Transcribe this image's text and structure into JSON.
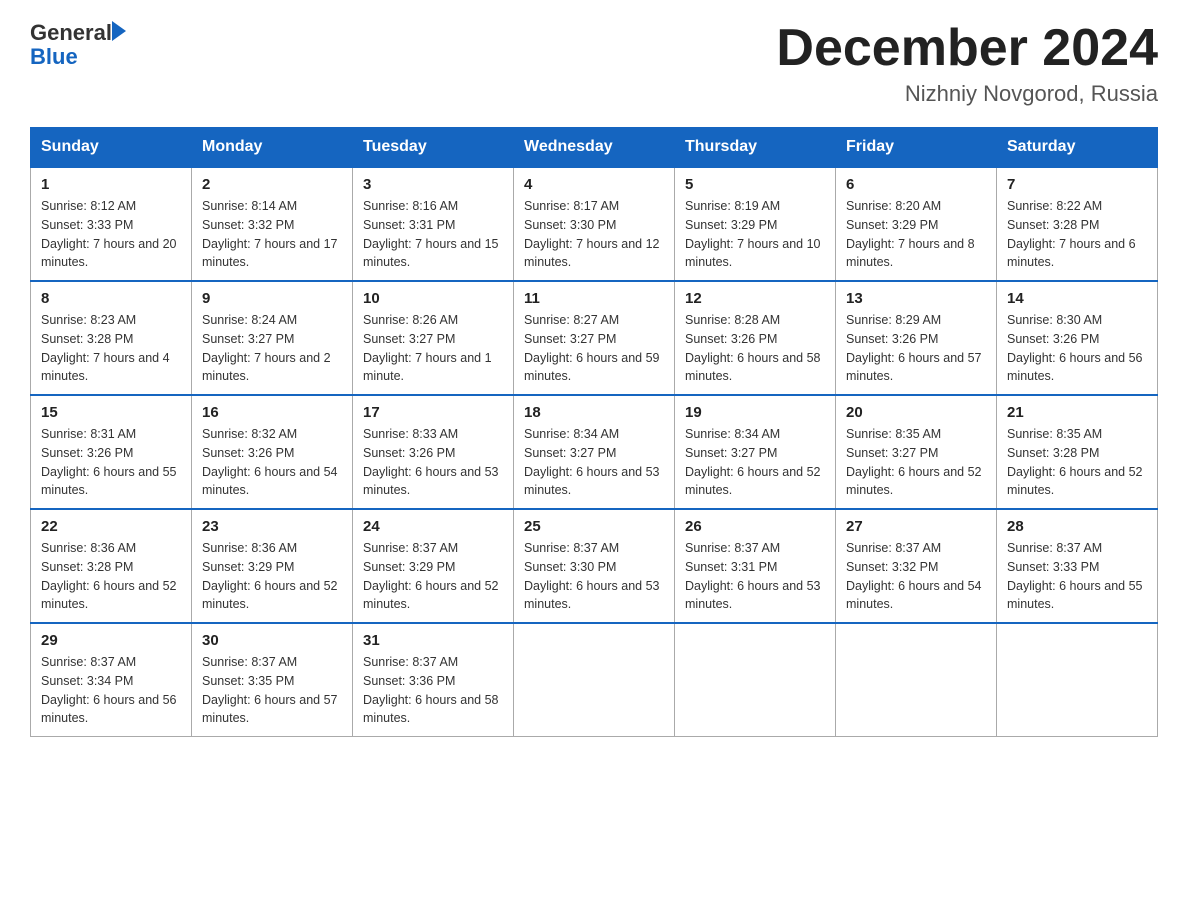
{
  "header": {
    "logo_general": "General",
    "logo_blue": "Blue",
    "title": "December 2024",
    "location": "Nizhniy Novgorod, Russia"
  },
  "weekdays": [
    "Sunday",
    "Monday",
    "Tuesday",
    "Wednesday",
    "Thursday",
    "Friday",
    "Saturday"
  ],
  "weeks": [
    [
      {
        "day": "1",
        "sunrise": "8:12 AM",
        "sunset": "3:33 PM",
        "daylight": "7 hours and 20 minutes."
      },
      {
        "day": "2",
        "sunrise": "8:14 AM",
        "sunset": "3:32 PM",
        "daylight": "7 hours and 17 minutes."
      },
      {
        "day": "3",
        "sunrise": "8:16 AM",
        "sunset": "3:31 PM",
        "daylight": "7 hours and 15 minutes."
      },
      {
        "day": "4",
        "sunrise": "8:17 AM",
        "sunset": "3:30 PM",
        "daylight": "7 hours and 12 minutes."
      },
      {
        "day": "5",
        "sunrise": "8:19 AM",
        "sunset": "3:29 PM",
        "daylight": "7 hours and 10 minutes."
      },
      {
        "day": "6",
        "sunrise": "8:20 AM",
        "sunset": "3:29 PM",
        "daylight": "7 hours and 8 minutes."
      },
      {
        "day": "7",
        "sunrise": "8:22 AM",
        "sunset": "3:28 PM",
        "daylight": "7 hours and 6 minutes."
      }
    ],
    [
      {
        "day": "8",
        "sunrise": "8:23 AM",
        "sunset": "3:28 PM",
        "daylight": "7 hours and 4 minutes."
      },
      {
        "day": "9",
        "sunrise": "8:24 AM",
        "sunset": "3:27 PM",
        "daylight": "7 hours and 2 minutes."
      },
      {
        "day": "10",
        "sunrise": "8:26 AM",
        "sunset": "3:27 PM",
        "daylight": "7 hours and 1 minute."
      },
      {
        "day": "11",
        "sunrise": "8:27 AM",
        "sunset": "3:27 PM",
        "daylight": "6 hours and 59 minutes."
      },
      {
        "day": "12",
        "sunrise": "8:28 AM",
        "sunset": "3:26 PM",
        "daylight": "6 hours and 58 minutes."
      },
      {
        "day": "13",
        "sunrise": "8:29 AM",
        "sunset": "3:26 PM",
        "daylight": "6 hours and 57 minutes."
      },
      {
        "day": "14",
        "sunrise": "8:30 AM",
        "sunset": "3:26 PM",
        "daylight": "6 hours and 56 minutes."
      }
    ],
    [
      {
        "day": "15",
        "sunrise": "8:31 AM",
        "sunset": "3:26 PM",
        "daylight": "6 hours and 55 minutes."
      },
      {
        "day": "16",
        "sunrise": "8:32 AM",
        "sunset": "3:26 PM",
        "daylight": "6 hours and 54 minutes."
      },
      {
        "day": "17",
        "sunrise": "8:33 AM",
        "sunset": "3:26 PM",
        "daylight": "6 hours and 53 minutes."
      },
      {
        "day": "18",
        "sunrise": "8:34 AM",
        "sunset": "3:27 PM",
        "daylight": "6 hours and 53 minutes."
      },
      {
        "day": "19",
        "sunrise": "8:34 AM",
        "sunset": "3:27 PM",
        "daylight": "6 hours and 52 minutes."
      },
      {
        "day": "20",
        "sunrise": "8:35 AM",
        "sunset": "3:27 PM",
        "daylight": "6 hours and 52 minutes."
      },
      {
        "day": "21",
        "sunrise": "8:35 AM",
        "sunset": "3:28 PM",
        "daylight": "6 hours and 52 minutes."
      }
    ],
    [
      {
        "day": "22",
        "sunrise": "8:36 AM",
        "sunset": "3:28 PM",
        "daylight": "6 hours and 52 minutes."
      },
      {
        "day": "23",
        "sunrise": "8:36 AM",
        "sunset": "3:29 PM",
        "daylight": "6 hours and 52 minutes."
      },
      {
        "day": "24",
        "sunrise": "8:37 AM",
        "sunset": "3:29 PM",
        "daylight": "6 hours and 52 minutes."
      },
      {
        "day": "25",
        "sunrise": "8:37 AM",
        "sunset": "3:30 PM",
        "daylight": "6 hours and 53 minutes."
      },
      {
        "day": "26",
        "sunrise": "8:37 AM",
        "sunset": "3:31 PM",
        "daylight": "6 hours and 53 minutes."
      },
      {
        "day": "27",
        "sunrise": "8:37 AM",
        "sunset": "3:32 PM",
        "daylight": "6 hours and 54 minutes."
      },
      {
        "day": "28",
        "sunrise": "8:37 AM",
        "sunset": "3:33 PM",
        "daylight": "6 hours and 55 minutes."
      }
    ],
    [
      {
        "day": "29",
        "sunrise": "8:37 AM",
        "sunset": "3:34 PM",
        "daylight": "6 hours and 56 minutes."
      },
      {
        "day": "30",
        "sunrise": "8:37 AM",
        "sunset": "3:35 PM",
        "daylight": "6 hours and 57 minutes."
      },
      {
        "day": "31",
        "sunrise": "8:37 AM",
        "sunset": "3:36 PM",
        "daylight": "6 hours and 58 minutes."
      },
      null,
      null,
      null,
      null
    ]
  ]
}
